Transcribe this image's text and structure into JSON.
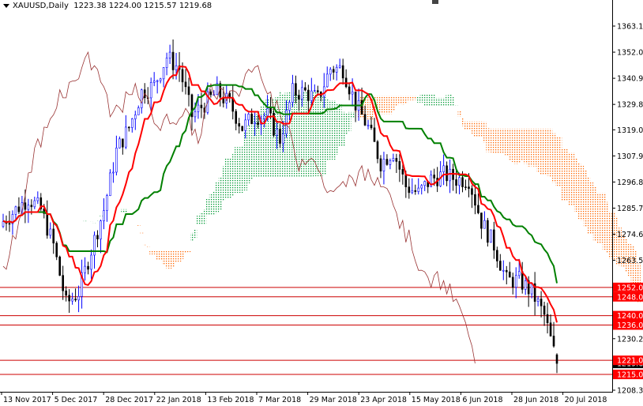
{
  "header": {
    "symbol": "XAUUSD,Daily",
    "ohlc": "1223.38 1224.00 1215.57 1219.68"
  },
  "chart_data": {
    "type": "candlestick",
    "title": "XAUUSD,Daily",
    "indicators": [
      "Ichimoku Kinko Hyo"
    ],
    "ylim": [
      1205,
      1370
    ],
    "y_ticks": [
      "1363.10",
      "1352.00",
      "1340.90",
      "1329.80",
      "1319.00",
      "1307.90",
      "1296.80",
      "1285.70",
      "1274.60",
      "1263.50",
      "1230.20",
      "1208.30"
    ],
    "x_ticks": [
      "13 Nov 2017",
      "5 Dec 2017",
      "28 Dec 2017",
      "22 Jan 2018",
      "13 Feb 2018",
      "7 Mar 2018",
      "29 Mar 2018",
      "23 Apr 2018",
      "15 May 2018",
      "6 Jun 2018",
      "28 Jun 2018",
      "20 Jul 2018"
    ],
    "close_every_4_bars": [
      1280,
      1285,
      1290,
      1285,
      1270,
      1245,
      1250,
      1268,
      1285,
      1310,
      1320,
      1335,
      1338,
      1350,
      1345,
      1325,
      1330,
      1335,
      1330,
      1320,
      1325,
      1325,
      1315,
      1335,
      1335,
      1332,
      1345,
      1345,
      1330,
      1320,
      1305,
      1310,
      1295,
      1292,
      1298,
      1300,
      1298,
      1298,
      1280,
      1270,
      1255,
      1255,
      1250,
      1240,
      1219.68
    ],
    "levels": [
      {
        "label": "1252.00",
        "value": 1252
      },
      {
        "label": "1248.00",
        "value": 1248
      },
      {
        "label": "1240.00",
        "value": 1240
      },
      {
        "label": "1236.00",
        "value": 1236
      },
      {
        "label": "1221.00",
        "value": 1221
      },
      {
        "label": "1215.00",
        "value": 1215
      }
    ],
    "current_price": {
      "label": "1219.68",
      "value": 1219.68
    },
    "colors": {
      "bull": "#0000ff",
      "bear": "#000000",
      "tenkan": "#ff0000",
      "kijun": "#008000",
      "chikou": "#993333",
      "cloud_bear": "#ff6600",
      "cloud_bull": "#009933",
      "level": "#cc0000",
      "level_label_bg": "#ff0000"
    }
  }
}
